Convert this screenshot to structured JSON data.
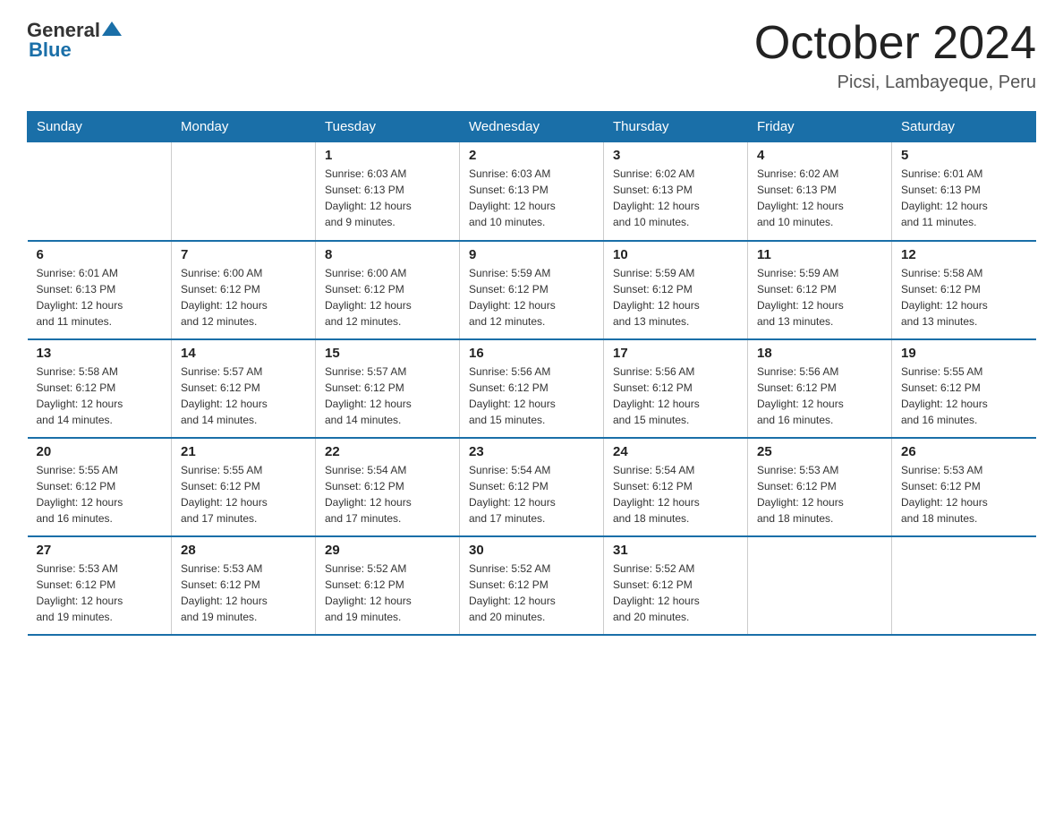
{
  "header": {
    "logo": {
      "text_general": "General",
      "text_blue": "Blue"
    },
    "title": "October 2024",
    "subtitle": "Picsi, Lambayeque, Peru"
  },
  "days_of_week": [
    "Sunday",
    "Monday",
    "Tuesday",
    "Wednesday",
    "Thursday",
    "Friday",
    "Saturday"
  ],
  "weeks": [
    [
      {
        "day": "",
        "info": ""
      },
      {
        "day": "",
        "info": ""
      },
      {
        "day": "1",
        "info": "Sunrise: 6:03 AM\nSunset: 6:13 PM\nDaylight: 12 hours\nand 9 minutes."
      },
      {
        "day": "2",
        "info": "Sunrise: 6:03 AM\nSunset: 6:13 PM\nDaylight: 12 hours\nand 10 minutes."
      },
      {
        "day": "3",
        "info": "Sunrise: 6:02 AM\nSunset: 6:13 PM\nDaylight: 12 hours\nand 10 minutes."
      },
      {
        "day": "4",
        "info": "Sunrise: 6:02 AM\nSunset: 6:13 PM\nDaylight: 12 hours\nand 10 minutes."
      },
      {
        "day": "5",
        "info": "Sunrise: 6:01 AM\nSunset: 6:13 PM\nDaylight: 12 hours\nand 11 minutes."
      }
    ],
    [
      {
        "day": "6",
        "info": "Sunrise: 6:01 AM\nSunset: 6:13 PM\nDaylight: 12 hours\nand 11 minutes."
      },
      {
        "day": "7",
        "info": "Sunrise: 6:00 AM\nSunset: 6:12 PM\nDaylight: 12 hours\nand 12 minutes."
      },
      {
        "day": "8",
        "info": "Sunrise: 6:00 AM\nSunset: 6:12 PM\nDaylight: 12 hours\nand 12 minutes."
      },
      {
        "day": "9",
        "info": "Sunrise: 5:59 AM\nSunset: 6:12 PM\nDaylight: 12 hours\nand 12 minutes."
      },
      {
        "day": "10",
        "info": "Sunrise: 5:59 AM\nSunset: 6:12 PM\nDaylight: 12 hours\nand 13 minutes."
      },
      {
        "day": "11",
        "info": "Sunrise: 5:59 AM\nSunset: 6:12 PM\nDaylight: 12 hours\nand 13 minutes."
      },
      {
        "day": "12",
        "info": "Sunrise: 5:58 AM\nSunset: 6:12 PM\nDaylight: 12 hours\nand 13 minutes."
      }
    ],
    [
      {
        "day": "13",
        "info": "Sunrise: 5:58 AM\nSunset: 6:12 PM\nDaylight: 12 hours\nand 14 minutes."
      },
      {
        "day": "14",
        "info": "Sunrise: 5:57 AM\nSunset: 6:12 PM\nDaylight: 12 hours\nand 14 minutes."
      },
      {
        "day": "15",
        "info": "Sunrise: 5:57 AM\nSunset: 6:12 PM\nDaylight: 12 hours\nand 14 minutes."
      },
      {
        "day": "16",
        "info": "Sunrise: 5:56 AM\nSunset: 6:12 PM\nDaylight: 12 hours\nand 15 minutes."
      },
      {
        "day": "17",
        "info": "Sunrise: 5:56 AM\nSunset: 6:12 PM\nDaylight: 12 hours\nand 15 minutes."
      },
      {
        "day": "18",
        "info": "Sunrise: 5:56 AM\nSunset: 6:12 PM\nDaylight: 12 hours\nand 16 minutes."
      },
      {
        "day": "19",
        "info": "Sunrise: 5:55 AM\nSunset: 6:12 PM\nDaylight: 12 hours\nand 16 minutes."
      }
    ],
    [
      {
        "day": "20",
        "info": "Sunrise: 5:55 AM\nSunset: 6:12 PM\nDaylight: 12 hours\nand 16 minutes."
      },
      {
        "day": "21",
        "info": "Sunrise: 5:55 AM\nSunset: 6:12 PM\nDaylight: 12 hours\nand 17 minutes."
      },
      {
        "day": "22",
        "info": "Sunrise: 5:54 AM\nSunset: 6:12 PM\nDaylight: 12 hours\nand 17 minutes."
      },
      {
        "day": "23",
        "info": "Sunrise: 5:54 AM\nSunset: 6:12 PM\nDaylight: 12 hours\nand 17 minutes."
      },
      {
        "day": "24",
        "info": "Sunrise: 5:54 AM\nSunset: 6:12 PM\nDaylight: 12 hours\nand 18 minutes."
      },
      {
        "day": "25",
        "info": "Sunrise: 5:53 AM\nSunset: 6:12 PM\nDaylight: 12 hours\nand 18 minutes."
      },
      {
        "day": "26",
        "info": "Sunrise: 5:53 AM\nSunset: 6:12 PM\nDaylight: 12 hours\nand 18 minutes."
      }
    ],
    [
      {
        "day": "27",
        "info": "Sunrise: 5:53 AM\nSunset: 6:12 PM\nDaylight: 12 hours\nand 19 minutes."
      },
      {
        "day": "28",
        "info": "Sunrise: 5:53 AM\nSunset: 6:12 PM\nDaylight: 12 hours\nand 19 minutes."
      },
      {
        "day": "29",
        "info": "Sunrise: 5:52 AM\nSunset: 6:12 PM\nDaylight: 12 hours\nand 19 minutes."
      },
      {
        "day": "30",
        "info": "Sunrise: 5:52 AM\nSunset: 6:12 PM\nDaylight: 12 hours\nand 20 minutes."
      },
      {
        "day": "31",
        "info": "Sunrise: 5:52 AM\nSunset: 6:12 PM\nDaylight: 12 hours\nand 20 minutes."
      },
      {
        "day": "",
        "info": ""
      },
      {
        "day": "",
        "info": ""
      }
    ]
  ]
}
